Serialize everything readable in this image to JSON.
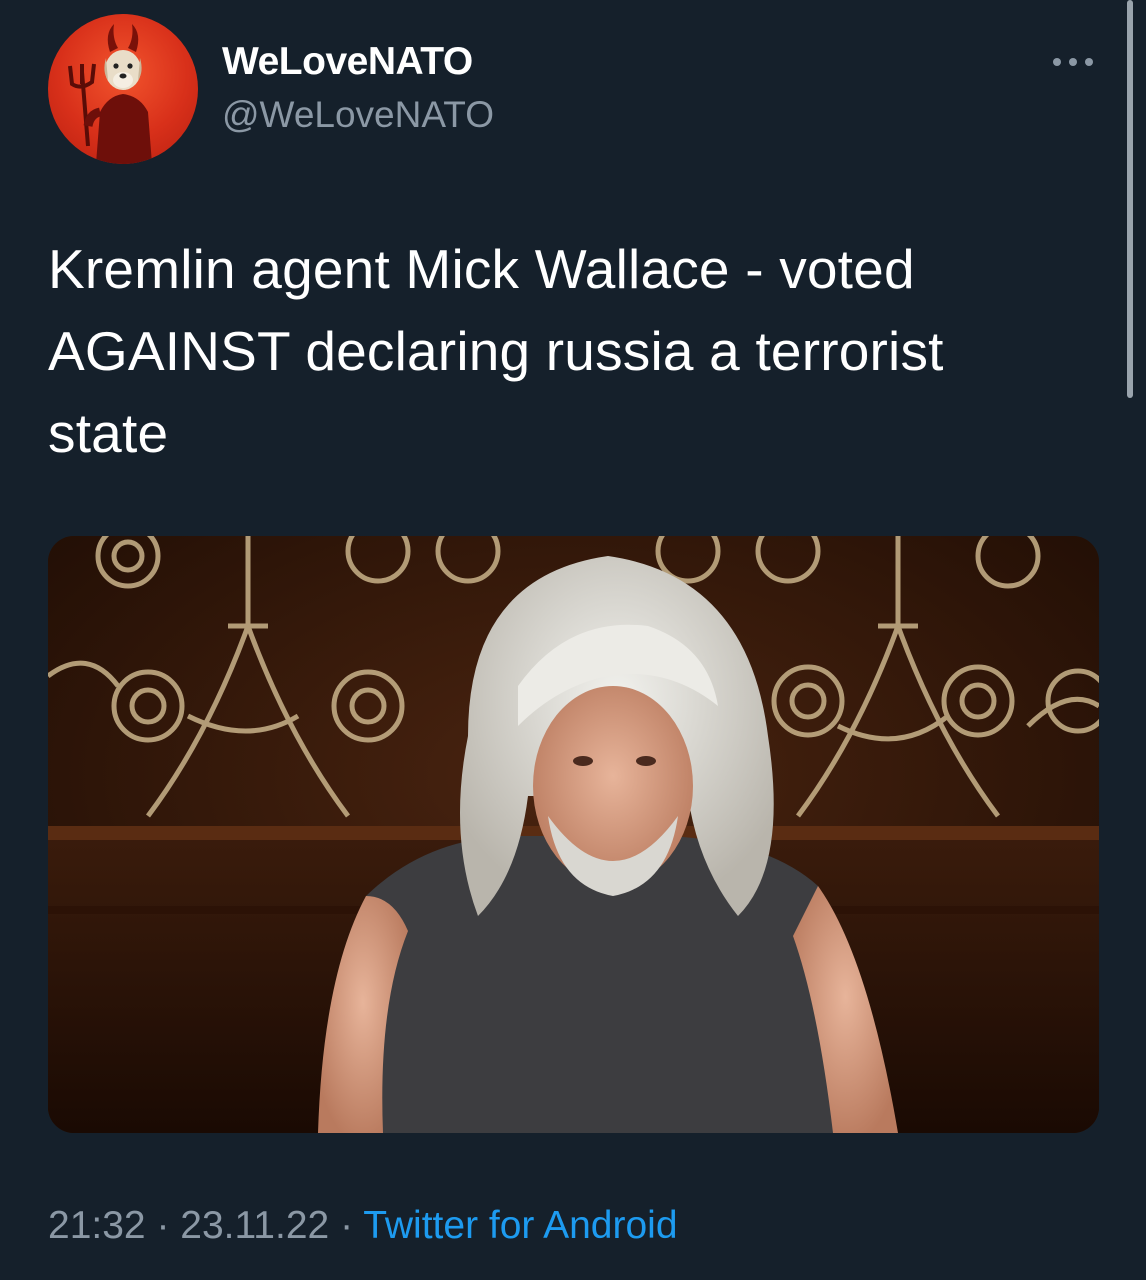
{
  "tweet": {
    "author": {
      "display_name": "WeLoveNATO",
      "handle": "@WeLoveNATO",
      "avatar_icon": "devil-dog-avatar"
    },
    "more_icon": "more-horizontal-icon",
    "text_lines": [
      "Kremlin agent Mick Wallace - voted",
      "AGAINST declaring russia a terrorist",
      "state"
    ],
    "time": "21:32",
    "separator": "·",
    "date": "23.11.22",
    "source": "Twitter for Android"
  },
  "colors": {
    "background": "#15202b",
    "text_primary": "#ffffff",
    "text_secondary": "#8b98a5",
    "link": "#1d9bf0"
  }
}
